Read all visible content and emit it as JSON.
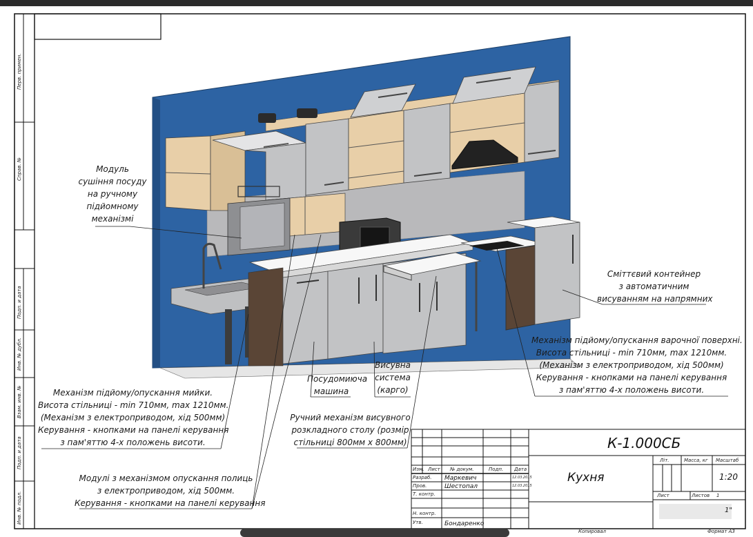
{
  "drawing": {
    "code": "К-1.000СБ",
    "title": "Кухня",
    "scale": "1:20",
    "sheet_label": "Лист",
    "sheets_label": "Листов",
    "sheets_value": "1",
    "lit_label": "Літ.",
    "mass_label": "Масса, кг",
    "scale_label": "Масштаб",
    "copied_label": "Копировал",
    "format_label": "Формат А3",
    "org_fragment": "1\""
  },
  "stamp_rows": {
    "izm": "Изм.",
    "list": "Лист",
    "doc": "№ докум.",
    "sign": "Подп.",
    "date": "Дата",
    "razrab_label": "Разраб.",
    "razrab_name": "Маркевич",
    "razrab_date": "12.03.2015",
    "prov_label": "Пров.",
    "prov_name": "Шестопал",
    "prov_date": "12.03.2015",
    "tkontr_label": "Т. контр.",
    "nkontr_label": "Н. контр.",
    "utv_label": "Утв.",
    "utv_name": "Бондаренко"
  },
  "left_strip": {
    "perv_primen": "Перв. примен.",
    "sprav": "Справ. №",
    "podp_data1": "Подп. и дата",
    "inv_dubl": "Инв. № дубл.",
    "vzam_inv": "Взам. инв. №",
    "podp_data2": "Подп. и дата",
    "inv_podl": "Инв. № подл."
  },
  "annotations": {
    "dish_dryer": [
      "Модуль",
      "сушіння посуду",
      "на ручному",
      "підйомному",
      "механізмі"
    ],
    "trash": [
      "Сміттєвий контейнер",
      "з автоматичним",
      "висуванням на напрямних"
    ],
    "cooktop": [
      "Механізм підйому/опускання варочної поверхні.",
      "Висота стільниці - min 710мм, max 1210мм.",
      "(Механізм з електроприводом, хід 500мм)",
      "Керування - кнопками на панелі керування",
      "з пам'яттю 4-х положень висоти."
    ],
    "sink": [
      "Механізм підйому/опускання мийки.",
      "Висота стільниці - min 710мм, max 1210мм.",
      "(Механізм з електроприводом, хід 500мм)",
      "Керування - кнопками на панелі керування",
      "з пам'яттю 4-х положень висоти."
    ],
    "dishwasher": [
      "Посудомиюча",
      "машина"
    ],
    "cargo": [
      "Висувна",
      "система",
      "(карго)"
    ],
    "table": [
      "Ручний механізм висувного",
      "розкладного столу (розмір",
      "стільниці 800мм х 800мм)"
    ],
    "shelves": [
      "Модулі з механізмом опускання полиць",
      "з електроприводом, хід 500мм.",
      "Керування - кнопками на панелі керування"
    ]
  },
  "colors": {
    "wall": "#2d63a3",
    "cabinet": "#c2c3c5",
    "wood": "#e8cfa8",
    "counter": "#ffffff",
    "dark": "#3c3c3c"
  }
}
